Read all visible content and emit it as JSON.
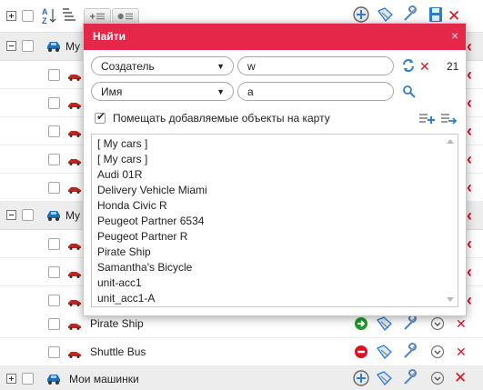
{
  "toolbar": {
    "icons": [
      "expand-all-icon",
      "select-all-checkbox",
      "sort-alpha-icon",
      "sort-list-icon",
      "add-group-icon",
      "group-toggle-icon",
      "add-on-map-icon",
      "tracks-icon",
      "tools-icon",
      "save-icon",
      "delete-icon"
    ]
  },
  "groups": [
    {
      "name": "My",
      "expanded": true
    },
    {
      "name": "My",
      "expanded": true
    },
    {
      "name": "Мои машинки",
      "expanded": false
    }
  ],
  "units": [
    {
      "name": "Pirate Ship",
      "state_icon": "arrow-right-icon",
      "state_color": "#1e9a2a"
    },
    {
      "name": "Shuttle Bus",
      "state_icon": "minus-circle-icon",
      "state_color": "#e01020"
    }
  ],
  "dialog": {
    "title": "Найти",
    "close": "×",
    "filter1": {
      "property": "Создатель",
      "value": "w",
      "count": "21"
    },
    "filter2": {
      "property": "Имя",
      "value": "a"
    },
    "add_to_map_label": "Помещать добавляемые объекты на карту",
    "add_to_map_checked": true,
    "results": [
      "[ My cars ]",
      "[ My cars ]",
      "Audi 01R",
      "Delivery Vehicle Miami",
      "Honda Civic R",
      "Peugeot Partner 6534",
      "Peugeot Partner R",
      "Pirate Ship",
      "Samantha's Bicycle",
      "unit-acc1",
      "unit_acc1-A"
    ]
  },
  "colors": {
    "accent": "#e5284a",
    "delete_red": "#e01020",
    "group_bg": "#ededed",
    "blue_icon": "#2a7fd0"
  }
}
